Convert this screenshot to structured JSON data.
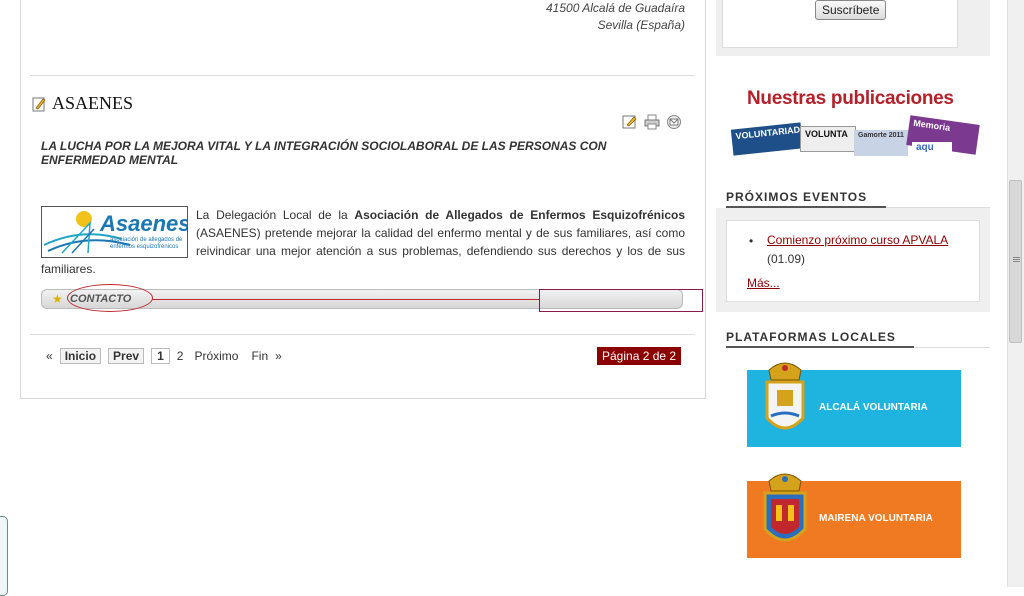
{
  "address": {
    "line1": "41500 Alcalá de Guadaíra",
    "line2": "Sevilla (España)"
  },
  "article": {
    "title": "ASAENES",
    "subtitle": "LA LUCHA POR LA MEJORA VITAL Y LA INTEGRACIÓN SOCIOLABORAL DE LAS PERSONAS CON ENFERMEDAD MENTAL",
    "body_pre": "La Delegación Local de la ",
    "body_bold": "Asociación de Allegados de Enfermos Esquizofrénicos",
    "body_post": " (ASAENES) pretende mejorar la calidad del enfermo mental y de sus familiares, así como reivindicar una mejor atención a sus problemas, defendiendo sus derechos y los de sus familiares.",
    "logo_text": "Asaenes",
    "logo_tagline": "asociación de allegados de enfermos esquizofrénicos",
    "contact_label": "CONTACTO",
    "tools": [
      "edit-icon",
      "print-icon",
      "email-icon"
    ]
  },
  "pagination": {
    "prev_arrow": "«",
    "start": "Inicio",
    "prev": "Prev",
    "current": "1",
    "page2": "2",
    "next": "Próximo",
    "end": "Fin",
    "next_arrow": "»",
    "page_status": "Página 2 de 2"
  },
  "sidebar": {
    "subscribe_label": "Suscríbete",
    "publications_title": "Nuestras publicaciones",
    "covers": [
      "VOLUNTARIADO",
      "VOLUNTA",
      "Gamorte 2011",
      "Memoria",
      "aqu"
    ],
    "events_title": "PRÓXIMOS EVENTOS",
    "event_link": "Comienzo próximo curso APVALA",
    "event_date": "(01.09)",
    "more_label": "Más...",
    "platforms_title": "PLATAFORMAS LOCALES",
    "platform1": "ALCALÁ VOLUNTARIA",
    "platform2": "MAIRENA VOLUNTARIA"
  },
  "colors": {
    "accent": "#8b0000",
    "alcala_banner": "#1fb4e0",
    "mairena_banner": "#f07a22"
  }
}
